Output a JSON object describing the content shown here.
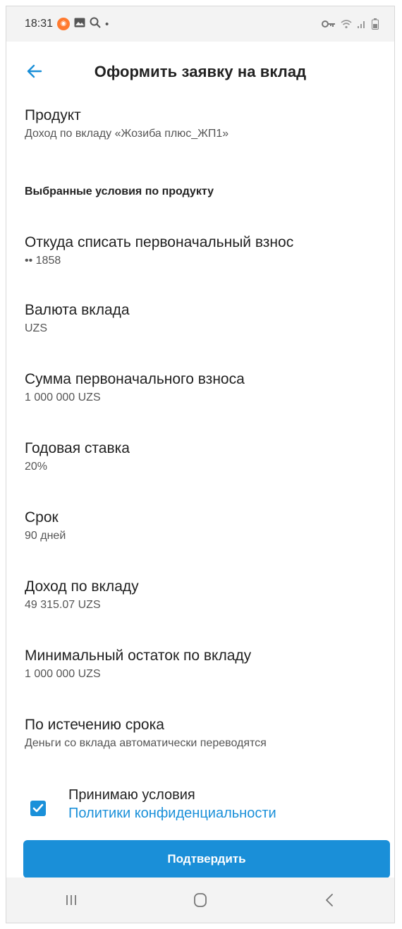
{
  "status_bar": {
    "time": "18:31",
    "icons_left": [
      "app-notification-icon",
      "gallery-icon",
      "search-icon",
      "dot-icon"
    ],
    "icons_right": [
      "vpn-key-icon",
      "wifi-icon",
      "signal-icon",
      "battery-icon"
    ]
  },
  "header": {
    "title": "Оформить заявку на вклад"
  },
  "product": {
    "label": "Продукт",
    "value": "Доход по вкладу «Жозиба плюс_ЖП1»"
  },
  "section_title": "Выбранные условия по продукту",
  "fields": [
    {
      "label": "Откуда списать первоначальный взнос",
      "value": "•• 1858"
    },
    {
      "label": "Валюта вклада",
      "value": "UZS"
    },
    {
      "label": "Сумма первоначального взноса",
      "value": "1 000 000 UZS"
    },
    {
      "label": "Годовая ставка",
      "value": "20%"
    },
    {
      "label": "Срок",
      "value": "90 дней"
    },
    {
      "label": "Доход по вкладу",
      "value": "49 315.07 UZS"
    },
    {
      "label": "Минимальный остаток по вкладу",
      "value": "1 000 000 UZS"
    },
    {
      "label": "По истечению срока",
      "value": "Деньги со вклада автоматически переводятся"
    }
  ],
  "agreement": {
    "checked": true,
    "label": "Принимаю условия",
    "link": "Политики конфиденциальности"
  },
  "confirm_button": "Подтвердить",
  "colors": {
    "accent": "#1a8fd8",
    "link": "#1a90d9",
    "app_notification": "#ff7a2f"
  }
}
